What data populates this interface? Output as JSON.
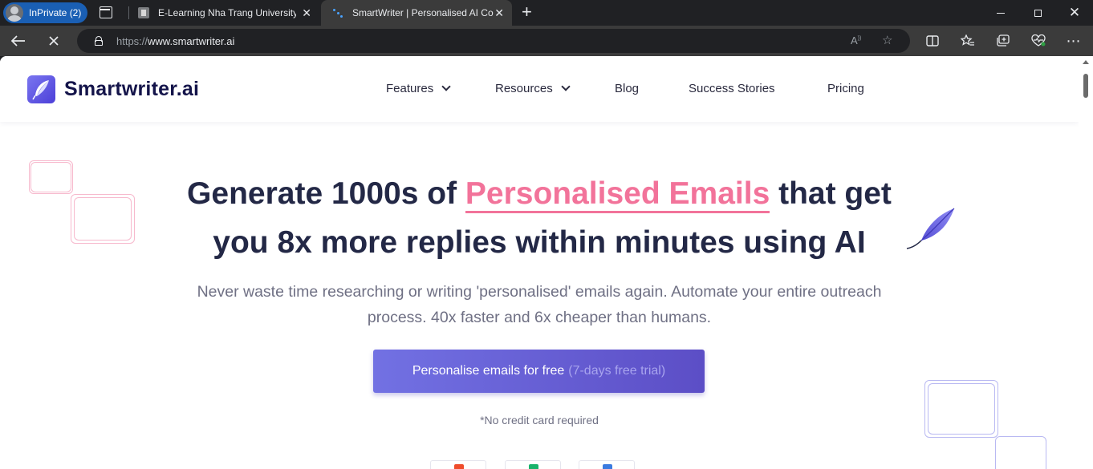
{
  "browser": {
    "profile_label": "InPrivate (2)",
    "tabs": [
      {
        "title": "E-Learning Nha Trang University",
        "close": "✕"
      },
      {
        "title": "SmartWriter | Personalised AI Co",
        "close": "✕"
      }
    ],
    "new_tab": "+",
    "url_protocol": "https://",
    "url_host": "www.smartwriter.ai",
    "window_close": "✕",
    "icons": [
      "back-icon",
      "stop-loading-icon",
      "lock-icon",
      "read-aloud-icon",
      "favorite-star-icon",
      "split-screen-icon",
      "favorites-icon",
      "collections-icon",
      "browser-essentials-icon",
      "more-icon"
    ]
  },
  "site": {
    "logo": "Smartwriter.ai",
    "nav": {
      "features": "Features",
      "resources": "Resources",
      "blog": "Blog",
      "success_stories": "Success Stories",
      "pricing": "Pricing"
    }
  },
  "hero": {
    "headline_prefix": "Generate 1000s of ",
    "headline_highlight": "Personalised Emails",
    "headline_suffix": " that get",
    "headline_line2": "you 8x more replies within minutes using AI",
    "subtitle_line1": "Never waste time researching or writing 'personalised' emails again. Automate your entire outreach",
    "subtitle_line2": "process. 40x faster and 6x cheaper than humans.",
    "cta_main": "Personalise emails for free",
    "cta_muted": "(7-days free trial)",
    "no_credit_card": "*No credit card required"
  },
  "colors": {
    "brand_navy": "#14144a",
    "highlight_pink": "#f2739a",
    "cta_purple": "#6663d8",
    "browser_dark": "#202124"
  }
}
